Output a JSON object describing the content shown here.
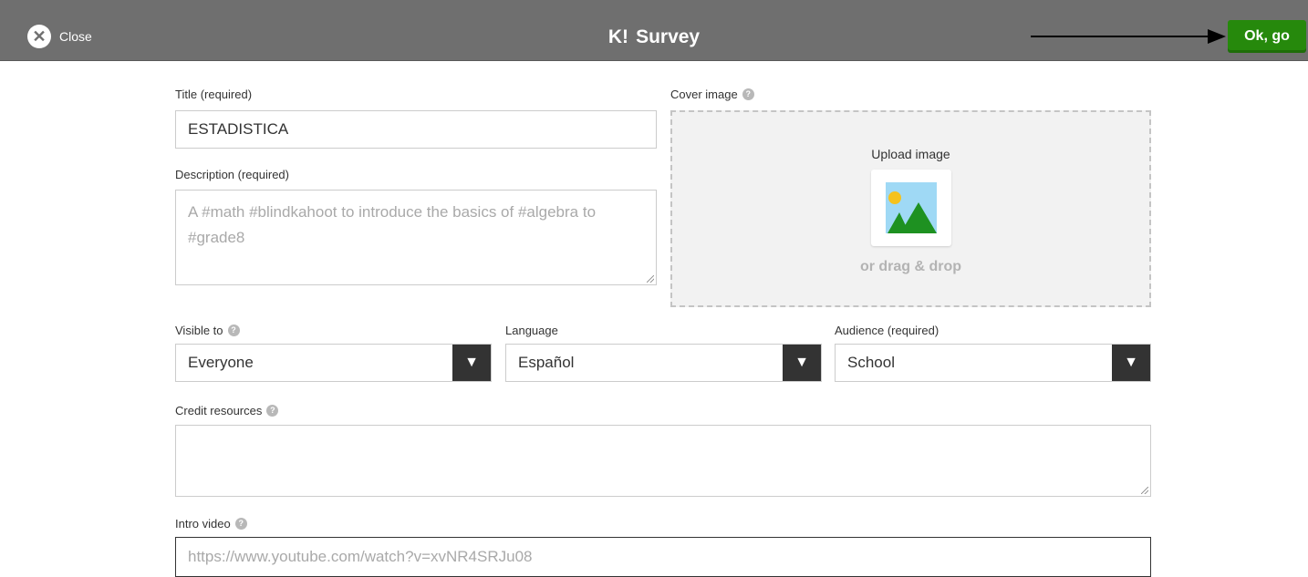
{
  "topbar": {
    "close_label": "Close",
    "logo": "K!",
    "title": "Survey",
    "ok_label": "Ok, go",
    "close_icon": "x-circle-icon",
    "arrow_icon": "arrow-right-icon",
    "ok_color": "#26890c"
  },
  "form": {
    "title": {
      "label": "Title (required)",
      "value": "ESTADISTICA"
    },
    "description": {
      "label": "Description (required)",
      "placeholder": "A #math #blindkahoot to introduce the basics of #algebra to #grade8"
    },
    "cover": {
      "label": "Cover image",
      "upload_label": "Upload image",
      "drag_label": "or drag & drop",
      "icon": "image-placeholder-icon"
    },
    "visible_to": {
      "label": "Visible to",
      "value": "Everyone"
    },
    "language": {
      "label": "Language",
      "value": "Español"
    },
    "audience": {
      "label": "Audience (required)",
      "value": "School"
    },
    "credit": {
      "label": "Credit resources",
      "value": ""
    },
    "intro_video": {
      "label": "Intro video",
      "placeholder": "https://www.youtube.com/watch?v=xvNR4SRJu08"
    }
  }
}
